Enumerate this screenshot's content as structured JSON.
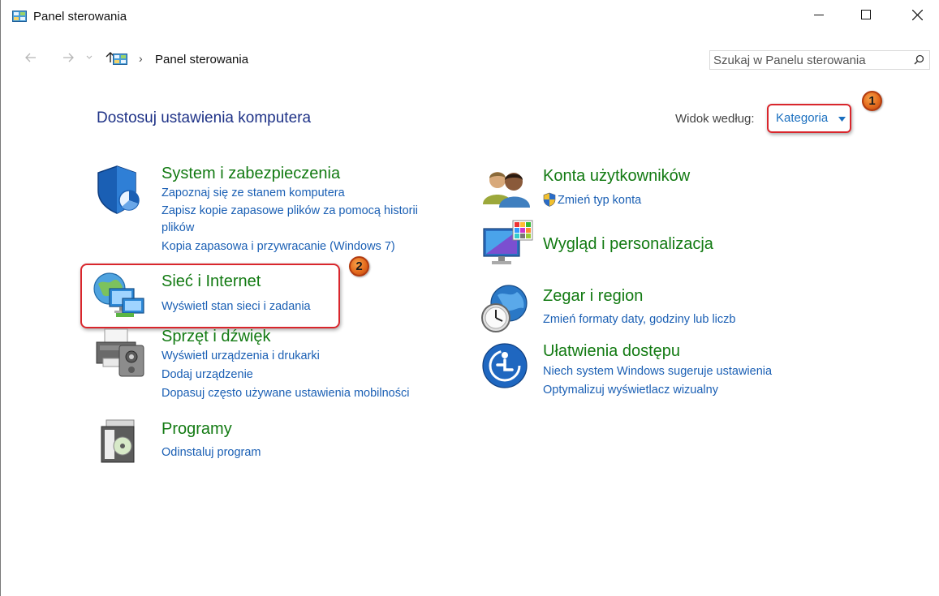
{
  "window": {
    "title": "Panel sterowania"
  },
  "address": {
    "crumb": "Panel sterowania",
    "search_placeholder": "Szukaj w Panelu sterowania"
  },
  "content": {
    "heading": "Dostosuj ustawienia komputera",
    "view_label": "Widok według:",
    "view_value": "Kategoria",
    "badge1": "1",
    "badge2": "2"
  },
  "categories": [
    {
      "title": "System i zabezpieczenia",
      "icon": "shield-icon",
      "links": [
        "Zapoznaj się ze stanem komputera",
        "Zapisz kopie zapasowe plików za pomocą historii",
        "plików",
        "Kopia zapasowa i przywracanie (Windows 7)"
      ]
    },
    {
      "title": "Sieć i Internet",
      "icon": "network-globe-icon",
      "links": [
        "Wyświetl stan sieci i zadania"
      ]
    },
    {
      "title": "Sprzęt i dźwięk",
      "icon": "printer-speaker-icon",
      "links": [
        "Wyświetl urządzenia i drukarki",
        "Dodaj urządzenie",
        "Dopasuj często używane ustawienia mobilności"
      ]
    },
    {
      "title": "Programy",
      "icon": "programs-icon",
      "links": [
        "Odinstaluj program"
      ]
    },
    {
      "title": "Konta użytkowników",
      "icon": "users-icon",
      "links": [
        "Zmień typ konta"
      ]
    },
    {
      "title": "Wygląd i personalizacja",
      "icon": "monitor-palette-icon",
      "links": []
    },
    {
      "title": "Zegar i region",
      "icon": "clock-globe-icon",
      "links": [
        "Zmień formaty daty, godziny lub liczb"
      ]
    },
    {
      "title": "Ułatwienia dostępu",
      "icon": "ease-of-access-icon",
      "links": [
        "Niech system Windows sugeruje ustawienia",
        "Optymalizuj wyświetlacz wizualny"
      ]
    }
  ]
}
